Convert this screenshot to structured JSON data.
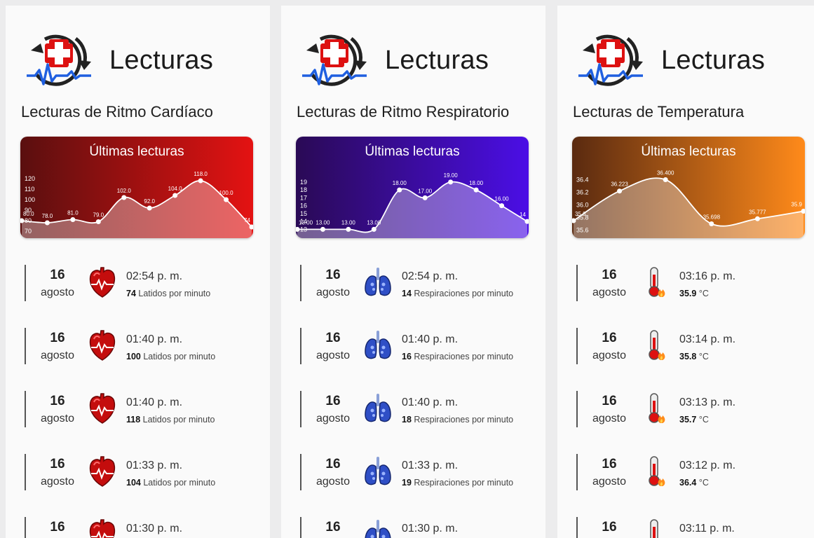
{
  "panels": [
    {
      "title": "Lecturas",
      "section": "Lecturas de Ritmo Cardíaco",
      "chart_title": "Últimas lecturas",
      "icon": "heart-icon",
      "colors": {
        "from": "#5a0f0f",
        "to": "#e41212"
      },
      "readings": [
        {
          "day": "16",
          "month": "agosto",
          "time": "02:54 p. m.",
          "value": "74",
          "unit": "Latidos por minuto"
        },
        {
          "day": "16",
          "month": "agosto",
          "time": "01:40 p. m.",
          "value": "100",
          "unit": "Latidos por minuto"
        },
        {
          "day": "16",
          "month": "agosto",
          "time": "01:40 p. m.",
          "value": "118",
          "unit": "Latidos por minuto"
        },
        {
          "day": "16",
          "month": "agosto",
          "time": "01:33 p. m.",
          "value": "104",
          "unit": "Latidos por minuto"
        },
        {
          "day": "16",
          "month": "agosto",
          "time": "01:30 p. m.",
          "value": "",
          "unit": ""
        }
      ]
    },
    {
      "title": "Lecturas",
      "section": "Lecturas de Ritmo Respiratorio",
      "chart_title": "Últimas lecturas",
      "icon": "lungs-icon",
      "colors": {
        "from": "#2a0a55",
        "to": "#4b0ee6"
      },
      "readings": [
        {
          "day": "16",
          "month": "agosto",
          "time": "02:54 p. m.",
          "value": "14",
          "unit": "Respiraciones por minuto"
        },
        {
          "day": "16",
          "month": "agosto",
          "time": "01:40 p. m.",
          "value": "16",
          "unit": "Respiraciones por minuto"
        },
        {
          "day": "16",
          "month": "agosto",
          "time": "01:40 p. m.",
          "value": "18",
          "unit": "Respiraciones por minuto"
        },
        {
          "day": "16",
          "month": "agosto",
          "time": "01:33 p. m.",
          "value": "19",
          "unit": "Respiraciones por minuto"
        },
        {
          "day": "16",
          "month": "agosto",
          "time": "01:30 p. m.",
          "value": "",
          "unit": ""
        }
      ]
    },
    {
      "title": "Lecturas",
      "section": "Lecturas de Temperatura",
      "chart_title": "Últimas lecturas",
      "icon": "thermometer-icon",
      "colors": {
        "from": "#5a2a10",
        "to": "#ff8a1a"
      },
      "readings": [
        {
          "day": "16",
          "month": "agosto",
          "time": "03:16 p. m.",
          "value": "35.9",
          "unit": "°C"
        },
        {
          "day": "16",
          "month": "agosto",
          "time": "03:14 p. m.",
          "value": "35.8",
          "unit": "°C"
        },
        {
          "day": "16",
          "month": "agosto",
          "time": "03:13 p. m.",
          "value": "35.7",
          "unit": "°C"
        },
        {
          "day": "16",
          "month": "agosto",
          "time": "03:12 p. m.",
          "value": "36.4",
          "unit": "°C"
        },
        {
          "day": "16",
          "month": "agosto",
          "time": "03:11 p. m.",
          "value": "",
          "unit": ""
        }
      ]
    }
  ],
  "chart_data": [
    {
      "type": "area",
      "title": "Últimas lecturas",
      "ylim": [
        68,
        128
      ],
      "yticks": [
        "70",
        "80",
        "90",
        "100",
        "110",
        "120"
      ],
      "labels": [
        "80.0",
        "78.0",
        "81.0",
        "79.0",
        "102.0",
        "92.0",
        "104.0",
        "118.0",
        "100.0",
        "74"
      ],
      "values": [
        80,
        78,
        81,
        79,
        102,
        92,
        104,
        118,
        100,
        74
      ]
    },
    {
      "type": "area",
      "title": "Últimas lecturas",
      "ylim": [
        12.5,
        20.5
      ],
      "yticks": [
        "13",
        "14",
        "15",
        "16",
        "17",
        "18",
        "19"
      ],
      "labels": [
        "13.00",
        "13.00",
        "13.00",
        "13.00",
        "18.00",
        "17.00",
        "19.00",
        "18.00",
        "16.00",
        "14"
      ],
      "values": [
        13,
        13,
        13,
        13,
        18,
        17,
        19,
        18,
        16,
        14
      ]
    },
    {
      "type": "area",
      "title": "Últimas lecturas",
      "ylim": [
        35.55,
        36.55
      ],
      "yticks": [
        "35.6",
        "35.8",
        "36.0",
        "36.2",
        "36.4"
      ],
      "labels": [
        "35.8",
        "36.223",
        "36.400",
        "35.698",
        "35.777",
        "35.9"
      ],
      "values": [
        35.75,
        36.22,
        36.4,
        35.7,
        35.78,
        35.9
      ]
    }
  ]
}
